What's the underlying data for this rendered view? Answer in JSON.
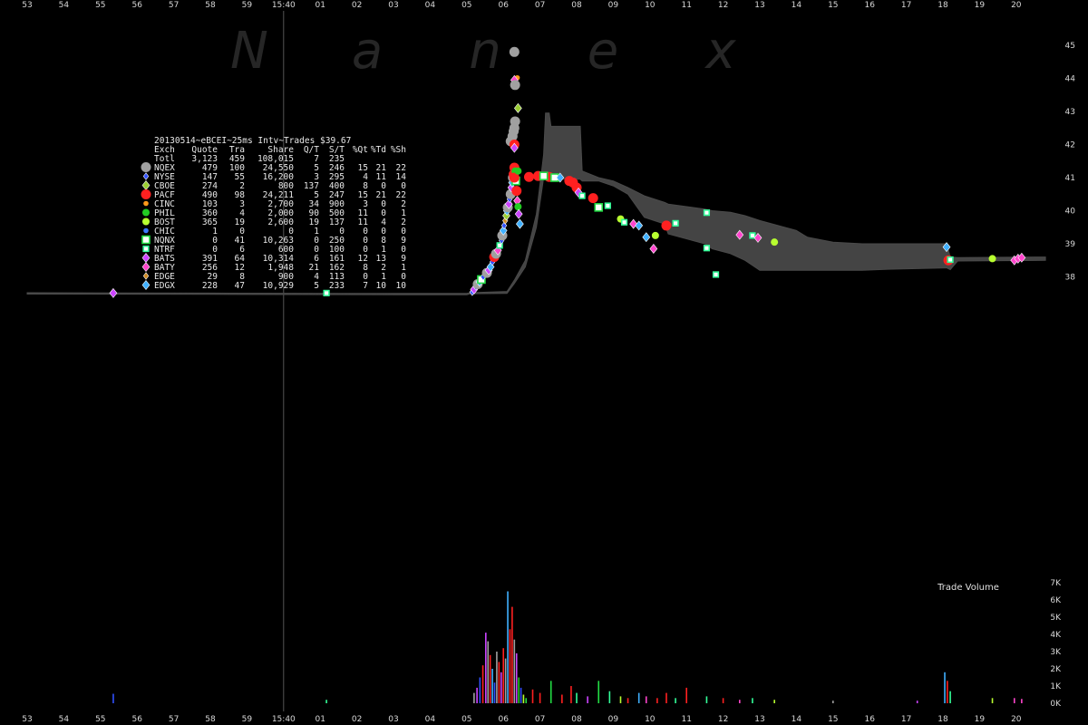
{
  "chart_data": {
    "type": "scatter",
    "watermark": [
      "N",
      "a",
      "n",
      "e",
      "x"
    ],
    "title": "20130514~eBCEI~25ms Intv~Trades $39.67",
    "x_ticks": [
      "53",
      "54",
      "55",
      "56",
      "57",
      "58",
      "59",
      "15:40",
      "01",
      "02",
      "03",
      "04",
      "05",
      "06",
      "07",
      "08",
      "09",
      "10",
      "11",
      "12",
      "13",
      "14",
      "15",
      "16",
      "17",
      "18",
      "19",
      "20"
    ],
    "x_range_seconds": [
      53,
      80.8
    ],
    "y_ticks": [
      "45",
      "44",
      "43",
      "42",
      "41",
      "40",
      "39",
      "38"
    ],
    "y_range": [
      37.35,
      45.4
    ],
    "volume_ticks": [
      "7K",
      "6K",
      "5K",
      "4K",
      "3K",
      "2K",
      "1K",
      "0K"
    ],
    "volume_range": [
      0,
      7000
    ],
    "volume_title": "Trade Volume",
    "legend": {
      "header": [
        "Exch",
        "Quote",
        "Tra",
        "Share",
        "Q/T",
        "S/T",
        "%Qt",
        "%Td",
        "%Sh"
      ],
      "total": [
        "Totl",
        "3,123",
        "459",
        "108,015",
        "7",
        "235",
        "",
        "",
        ""
      ],
      "rows": [
        {
          "name": "NQEX",
          "color": "#a0a0a0",
          "shape": "circle-lg",
          "cells": [
            "479",
            "100",
            "24,550",
            "5",
            "246",
            "15",
            "21",
            "22"
          ]
        },
        {
          "name": "NYSE",
          "color": "#3050ff",
          "shape": "diamond-sm",
          "cells": [
            "147",
            "55",
            "16,200",
            "3",
            "295",
            "4",
            "11",
            "14"
          ]
        },
        {
          "name": "CBOE",
          "color": "#9acd32",
          "shape": "diamond",
          "cells": [
            "274",
            "2",
            "800",
            "137",
            "400",
            "8",
            "0",
            "0"
          ]
        },
        {
          "name": "PACF",
          "color": "#ff2020",
          "shape": "circle-lg",
          "cells": [
            "490",
            "98",
            "24,211",
            "5",
            "247",
            "15",
            "21",
            "22"
          ]
        },
        {
          "name": "CINC",
          "color": "#ff9a1a",
          "shape": "circle-sm",
          "cells": [
            "103",
            "3",
            "2,700",
            "34",
            "900",
            "3",
            "0",
            "2"
          ]
        },
        {
          "name": "PHIL",
          "color": "#22cc22",
          "shape": "circle",
          "cells": [
            "360",
            "4",
            "2,000",
            "90",
            "500",
            "11",
            "0",
            "1"
          ]
        },
        {
          "name": "BOST",
          "color": "#b8ff30",
          "shape": "circle",
          "cells": [
            "365",
            "19",
            "2,600",
            "19",
            "137",
            "11",
            "4",
            "2"
          ]
        },
        {
          "name": "CHIC",
          "color": "#3a78ff",
          "shape": "circle-sm",
          "cells": [
            "1",
            "0",
            "0",
            "1",
            "0",
            "0",
            "0",
            "0"
          ]
        },
        {
          "name": "NQNX",
          "color": "#22dd44",
          "shape": "square",
          "cells": [
            "0",
            "41",
            "10,263",
            "0",
            "250",
            "0",
            "8",
            "9"
          ]
        },
        {
          "name": "NTRF",
          "color": "#33ff99",
          "shape": "square-sm",
          "cells": [
            "0",
            "6",
            "600",
            "0",
            "100",
            "0",
            "1",
            "0"
          ]
        },
        {
          "name": "BATS",
          "color": "#cc44ff",
          "shape": "diamond",
          "cells": [
            "391",
            "64",
            "10,314",
            "6",
            "161",
            "12",
            "13",
            "9"
          ]
        },
        {
          "name": "BATY",
          "color": "#ff44cc",
          "shape": "diamond",
          "cells": [
            "256",
            "12",
            "1,948",
            "21",
            "162",
            "8",
            "2",
            "1"
          ]
        },
        {
          "name": "EDGE",
          "color": "#d08a20",
          "shape": "diamond-sm",
          "cells": [
            "29",
            "8",
            "900",
            "4",
            "113",
            "0",
            "1",
            "0"
          ]
        },
        {
          "name": "EDGX",
          "color": "#40b0ff",
          "shape": "diamond",
          "cells": [
            "228",
            "47",
            "10,929",
            "5",
            "233",
            "7",
            "10",
            "10"
          ]
        }
      ]
    },
    "spread_band": [
      [
        53.0,
        37.48,
        37.52
      ],
      [
        58.0,
        37.47,
        37.51
      ],
      [
        63.0,
        37.46,
        37.5
      ],
      [
        65.0,
        37.46,
        37.5
      ],
      [
        65.1,
        37.49,
        37.52
      ],
      [
        66.1,
        37.5,
        37.56
      ],
      [
        66.3,
        37.8,
        37.9
      ],
      [
        66.6,
        38.3,
        38.5
      ],
      [
        66.9,
        39.5,
        39.9
      ],
      [
        67.1,
        41.0,
        41.7
      ],
      [
        67.15,
        41.0,
        42.95
      ],
      [
        67.25,
        40.95,
        42.95
      ],
      [
        67.3,
        40.95,
        42.55
      ],
      [
        68.1,
        40.95,
        42.55
      ],
      [
        68.15,
        40.9,
        41.2
      ],
      [
        68.6,
        40.9,
        41.0
      ],
      [
        69.0,
        40.75,
        40.9
      ],
      [
        69.4,
        40.5,
        40.7
      ],
      [
        69.85,
        39.8,
        40.45
      ],
      [
        70.4,
        39.6,
        40.25
      ],
      [
        70.5,
        39.3,
        40.2
      ],
      [
        71.5,
        39.0,
        40.05
      ],
      [
        71.7,
        38.85,
        40.0
      ],
      [
        72.2,
        38.7,
        39.95
      ],
      [
        72.6,
        38.5,
        39.85
      ],
      [
        73.0,
        38.2,
        39.7
      ],
      [
        74.0,
        38.2,
        39.4
      ],
      [
        74.3,
        38.2,
        39.2
      ],
      [
        75.0,
        38.2,
        39.05
      ],
      [
        75.8,
        38.2,
        39.0
      ],
      [
        76.5,
        38.23,
        39.0
      ],
      [
        78.1,
        38.27,
        39.0
      ],
      [
        78.2,
        38.22,
        38.6
      ],
      [
        78.4,
        38.48,
        38.58
      ],
      [
        80.8,
        38.5,
        38.6
      ]
    ],
    "points": [
      [
        55.35,
        37.51,
        "BATS"
      ],
      [
        61.17,
        37.51,
        "NTRF"
      ],
      [
        65.15,
        37.54,
        "NYSE"
      ],
      [
        65.2,
        37.62,
        "BATS"
      ],
      [
        65.25,
        37.7,
        "NYSE"
      ],
      [
        65.3,
        37.78,
        "NQEX"
      ],
      [
        65.35,
        37.85,
        "EDGX"
      ],
      [
        65.4,
        37.92,
        "NQNX"
      ],
      [
        65.45,
        38.0,
        "NYSE"
      ],
      [
        65.55,
        38.12,
        "NQEX"
      ],
      [
        65.6,
        38.2,
        "BATS"
      ],
      [
        65.65,
        38.3,
        "EDGX"
      ],
      [
        65.7,
        38.45,
        "NYSE"
      ],
      [
        65.75,
        38.6,
        "PACF"
      ],
      [
        65.8,
        38.7,
        "NQEX"
      ],
      [
        65.85,
        38.8,
        "BATY"
      ],
      [
        65.9,
        38.95,
        "NTRF"
      ],
      [
        65.95,
        39.1,
        "NYSE"
      ],
      [
        65.97,
        39.25,
        "NQEX"
      ],
      [
        66.0,
        39.4,
        "EDGX"
      ],
      [
        66.02,
        39.55,
        "NYSE"
      ],
      [
        66.05,
        39.7,
        "EDGE"
      ],
      [
        66.08,
        39.85,
        "CBOE"
      ],
      [
        66.1,
        40.0,
        "EDGX"
      ],
      [
        66.12,
        40.1,
        "NQEX"
      ],
      [
        66.15,
        40.2,
        "BATS"
      ],
      [
        66.17,
        40.35,
        "NYSE"
      ],
      [
        66.2,
        40.5,
        "NQEX"
      ],
      [
        66.22,
        40.7,
        "BATS"
      ],
      [
        66.24,
        40.85,
        "EDGX"
      ],
      [
        66.26,
        41.0,
        "NQEX"
      ],
      [
        66.28,
        41.1,
        "PACF"
      ],
      [
        66.3,
        41.3,
        "PACF"
      ],
      [
        66.32,
        41.2,
        "PHIL"
      ],
      [
        66.34,
        40.9,
        "NQNX"
      ],
      [
        66.36,
        40.6,
        "PACF"
      ],
      [
        66.38,
        40.3,
        "BATY"
      ],
      [
        66.4,
        40.12,
        "PHIL"
      ],
      [
        66.42,
        39.9,
        "BATS"
      ],
      [
        66.45,
        39.6,
        "EDGX"
      ],
      [
        66.3,
        41.0,
        "PACF"
      ],
      [
        66.4,
        41.2,
        "PHIL"
      ],
      [
        66.2,
        42.1,
        "NQEX"
      ],
      [
        66.25,
        42.25,
        "NQEX"
      ],
      [
        66.28,
        42.4,
        "NQEX"
      ],
      [
        66.3,
        42.5,
        "NQEX"
      ],
      [
        66.32,
        42.7,
        "NQEX"
      ],
      [
        66.3,
        42.0,
        "PACF"
      ],
      [
        66.3,
        41.9,
        "BATS"
      ],
      [
        66.4,
        43.1,
        "CBOE"
      ],
      [
        66.38,
        44.02,
        "CINC"
      ],
      [
        66.3,
        43.95,
        "BATY"
      ],
      [
        66.32,
        43.8,
        "NQEX"
      ],
      [
        66.3,
        44.8,
        "NQEX"
      ],
      [
        66.7,
        41.02,
        "PACF"
      ],
      [
        66.95,
        41.05,
        "PACF"
      ],
      [
        67.25,
        41.02,
        "PACF"
      ],
      [
        67.4,
        41.0,
        "NQNX"
      ],
      [
        67.1,
        41.05,
        "NQNX"
      ],
      [
        67.55,
        41.0,
        "EDGX"
      ],
      [
        67.8,
        40.9,
        "PACF"
      ],
      [
        67.9,
        40.85,
        "PACF"
      ],
      [
        68.0,
        40.7,
        "PACF"
      ],
      [
        68.05,
        40.55,
        "BATS"
      ],
      [
        68.15,
        40.45,
        "NTRF"
      ],
      [
        68.45,
        40.38,
        "PACF"
      ],
      [
        68.6,
        40.1,
        "NQNX"
      ],
      [
        68.85,
        40.15,
        "NTRF"
      ],
      [
        69.2,
        39.75,
        "BOST"
      ],
      [
        69.3,
        39.65,
        "NTRF"
      ],
      [
        69.55,
        39.6,
        "BATY"
      ],
      [
        69.7,
        39.55,
        "EDGX"
      ],
      [
        69.9,
        39.2,
        "EDGX"
      ],
      [
        70.1,
        38.85,
        "BATY"
      ],
      [
        70.45,
        39.55,
        "PACF"
      ],
      [
        70.15,
        39.25,
        "BOST"
      ],
      [
        70.7,
        39.62,
        "NTRF"
      ],
      [
        71.55,
        39.94,
        "NTRF"
      ],
      [
        71.55,
        38.87,
        "NTRF"
      ],
      [
        71.8,
        38.07,
        "NTRF"
      ],
      [
        72.45,
        39.27,
        "BATY"
      ],
      [
        72.8,
        39.25,
        "NTRF"
      ],
      [
        72.95,
        39.18,
        "BATY"
      ],
      [
        73.4,
        39.05,
        "BOST"
      ],
      [
        78.1,
        38.9,
        "EDGX"
      ],
      [
        78.15,
        38.5,
        "PACF"
      ],
      [
        78.2,
        38.52,
        "NTRF"
      ],
      [
        79.35,
        38.55,
        "BOST"
      ],
      [
        79.95,
        38.5,
        "BATY"
      ],
      [
        80.05,
        38.55,
        "BATY"
      ],
      [
        80.15,
        38.58,
        "BATY"
      ]
    ],
    "volume_bars": [
      [
        55.35,
        550,
        "NYSE"
      ],
      [
        61.17,
        200,
        "NTRF"
      ],
      [
        65.2,
        600,
        "NQEX"
      ],
      [
        65.28,
        900,
        "BATS"
      ],
      [
        65.36,
        1500,
        "NYSE"
      ],
      [
        65.44,
        2200,
        "PACF"
      ],
      [
        65.52,
        4100,
        "BATS"
      ],
      [
        65.58,
        3600,
        "NQEX"
      ],
      [
        65.64,
        2800,
        "PACF"
      ],
      [
        65.7,
        2000,
        "EDGX"
      ],
      [
        65.76,
        1200,
        "NYSE"
      ],
      [
        65.82,
        3000,
        "NQEX"
      ],
      [
        65.88,
        2400,
        "PACF"
      ],
      [
        65.94,
        1800,
        "BATS"
      ],
      [
        66.0,
        3200,
        "PACF"
      ],
      [
        66.06,
        2600,
        "NQEX"
      ],
      [
        66.12,
        6500,
        "EDGX"
      ],
      [
        66.18,
        4300,
        "PACF"
      ],
      [
        66.24,
        5600,
        "PACF"
      ],
      [
        66.3,
        3700,
        "NQEX"
      ],
      [
        66.36,
        2900,
        "BATS"
      ],
      [
        66.42,
        1500,
        "PHIL"
      ],
      [
        66.48,
        900,
        "NYSE"
      ],
      [
        66.55,
        500,
        "BOST"
      ],
      [
        66.62,
        300,
        "NQNX"
      ],
      [
        66.8,
        800,
        "PACF"
      ],
      [
        67.0,
        600,
        "PACF"
      ],
      [
        67.3,
        1300,
        "NQNX"
      ],
      [
        67.6,
        500,
        "PACF"
      ],
      [
        67.85,
        1000,
        "PACF"
      ],
      [
        68.0,
        600,
        "NTRF"
      ],
      [
        68.3,
        400,
        "BATS"
      ],
      [
        68.6,
        1300,
        "NQNX"
      ],
      [
        68.9,
        700,
        "NTRF"
      ],
      [
        69.2,
        400,
        "BOST"
      ],
      [
        69.4,
        300,
        "PACF"
      ],
      [
        69.7,
        600,
        "EDGX"
      ],
      [
        69.9,
        400,
        "BATY"
      ],
      [
        70.2,
        300,
        "PACF"
      ],
      [
        70.45,
        600,
        "PACF"
      ],
      [
        70.7,
        300,
        "NTRF"
      ],
      [
        71.0,
        900,
        "PACF"
      ],
      [
        71.55,
        400,
        "NTRF"
      ],
      [
        72.0,
        300,
        "PACF"
      ],
      [
        72.45,
        200,
        "BATY"
      ],
      [
        72.8,
        300,
        "NTRF"
      ],
      [
        73.4,
        200,
        "BOST"
      ],
      [
        75.0,
        150,
        "NQEX"
      ],
      [
        77.3,
        150,
        "BATS"
      ],
      [
        78.05,
        1800,
        "EDGX"
      ],
      [
        78.12,
        1300,
        "PACF"
      ],
      [
        78.2,
        700,
        "NTRF"
      ],
      [
        79.35,
        300,
        "BOST"
      ],
      [
        79.95,
        300,
        "BATY"
      ],
      [
        80.15,
        250,
        "BATY"
      ]
    ]
  }
}
